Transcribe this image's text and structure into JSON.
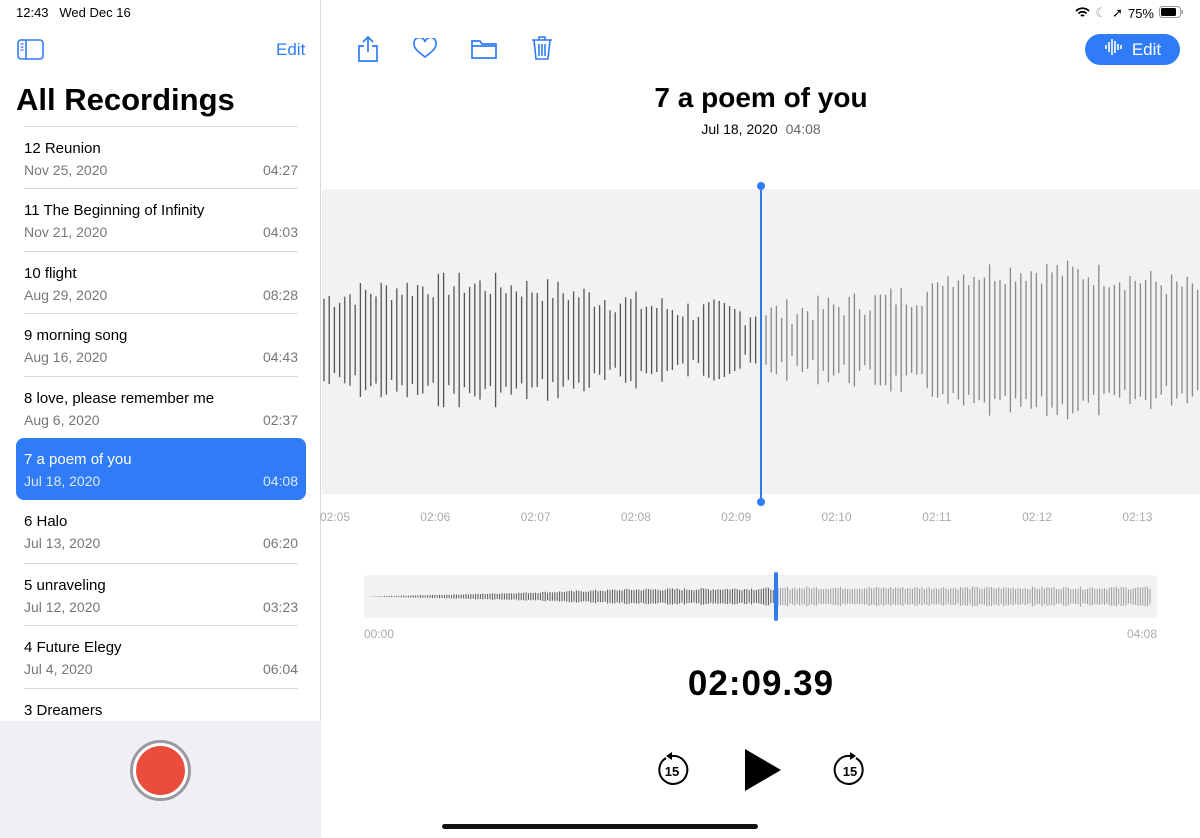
{
  "status": {
    "time": "12:43",
    "date": "Wed Dec 16",
    "battery": "75%"
  },
  "sidebar": {
    "edit_label": "Edit",
    "title": "All Recordings",
    "recordings": [
      {
        "title": "12 Reunion",
        "date": "Nov 25, 2020",
        "duration": "04:27"
      },
      {
        "title": "11 The Beginning of Infinity",
        "date": "Nov 21, 2020",
        "duration": "04:03"
      },
      {
        "title": "10 flight",
        "date": "Aug 29, 2020",
        "duration": "08:28"
      },
      {
        "title": "9 morning song",
        "date": "Aug 16, 2020",
        "duration": "04:43"
      },
      {
        "title": "8 love, please remember me",
        "date": "Aug 6, 2020",
        "duration": "02:37"
      },
      {
        "title": "7 a poem of you",
        "date": "Jul 18, 2020",
        "duration": "04:08",
        "selected": true
      },
      {
        "title": "6 Halo",
        "date": "Jul 13, 2020",
        "duration": "06:20"
      },
      {
        "title": "5 unraveling",
        "date": "Jul 12, 2020",
        "duration": "03:23"
      },
      {
        "title": "4 Future Elegy",
        "date": "Jul 4, 2020",
        "duration": "06:04"
      },
      {
        "title": "3 Dreamers",
        "date": "",
        "duration": ""
      }
    ]
  },
  "main": {
    "edit_label": "Edit",
    "title": "7 a poem of you",
    "date": "Jul 18, 2020",
    "duration": "04:08",
    "ticks": [
      "02:05",
      "02:06",
      "02:07",
      "02:08",
      "02:09",
      "02:10",
      "02:11",
      "02:12",
      "02:13"
    ],
    "overview_start": "00:00",
    "overview_end": "04:08",
    "playhead_fraction": 0.52,
    "timer": "02:09.39",
    "skip_back": "15",
    "skip_forward": "15"
  },
  "colors": {
    "accent": "#2f7cf6",
    "record": "#eb4d3d"
  }
}
